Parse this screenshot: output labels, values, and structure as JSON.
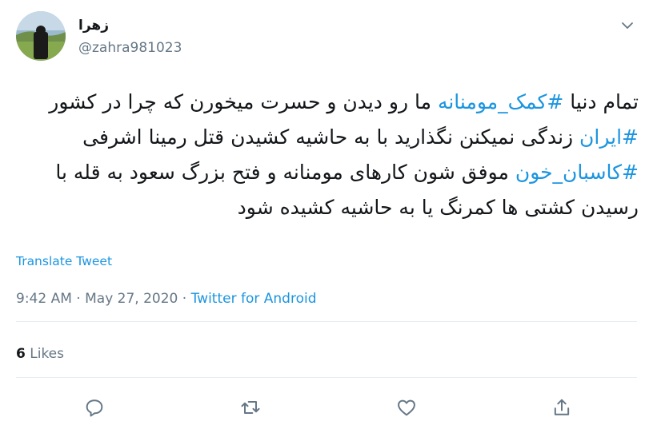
{
  "user": {
    "display_name": "زهرا",
    "handle": "@zahra981023"
  },
  "tweet": {
    "text_parts": [
      {
        "text": "تمام دنیا ",
        "type": "text"
      },
      {
        "text": "#کمک_مومنانه",
        "type": "hashtag"
      },
      {
        "text": " ما رو دیدن و حسرت میخورن که چرا در کشور ",
        "type": "text"
      },
      {
        "text": "#ایران",
        "type": "hashtag"
      },
      {
        "text": " زندگی نمیکنن نگذارید با به حاشیه کشیدن قتل رمینا اشرفی ",
        "type": "text"
      },
      {
        "text": "#کاسبان_خون",
        "type": "hashtag"
      },
      {
        "text": " موفق شون کارهای مومنانه و فتح بزرگ سعود به قله با رسیدن کشتی ها کمرنگ یا به حاشیه کشیده شود",
        "type": "text"
      }
    ],
    "translate_label": "Translate Tweet",
    "time": "9:42 AM",
    "date": "May 27, 2020",
    "separator": " · ",
    "source": "Twitter for Android"
  },
  "stats": {
    "likes_count": "6",
    "likes_label": "Likes"
  },
  "actions": [
    "reply-icon",
    "retweet-icon",
    "like-icon",
    "share-icon"
  ],
  "colors": {
    "link": "#1b95e0",
    "text": "#14171a",
    "secondary": "#657786",
    "divider": "#e6ecf0"
  }
}
